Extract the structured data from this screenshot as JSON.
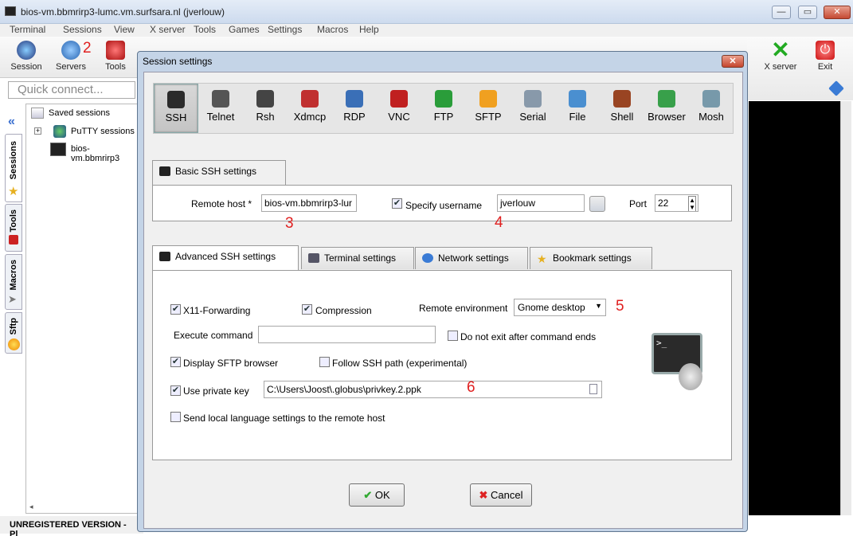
{
  "window": {
    "title": "bios-vm.bbmrirp3-lumc.vm.surfsara.nl (jverlouw)",
    "minimize": "—",
    "maximize": "▭",
    "close": "✕"
  },
  "menu": [
    "Terminal",
    "Sessions",
    "View",
    "X server",
    "Tools",
    "Games",
    "Settings",
    "Macros",
    "Help"
  ],
  "toolbar": {
    "session": "Session",
    "servers": "Servers",
    "servers_badge": "2",
    "tools": "Tools",
    "xserver": "X server",
    "exit": "Exit"
  },
  "quick_connect": {
    "placeholder": "Quick connect..."
  },
  "sidebar": {
    "tabs": [
      "Sessions",
      "Tools",
      "Macros",
      "Sftp"
    ]
  },
  "tree": {
    "root": "Saved sessions",
    "putty": "PuTTY sessions",
    "session": "bios-vm.bbmrirp3"
  },
  "status": {
    "text": "UNREGISTERED VERSION  -  Pl"
  },
  "dialog": {
    "title": "Session settings",
    "close": "✕",
    "protocols": [
      "SSH",
      "Telnet",
      "Rsh",
      "Xdmcp",
      "RDP",
      "VNC",
      "FTP",
      "SFTP",
      "Serial",
      "File",
      "Shell",
      "Browser",
      "Mosh"
    ],
    "protocol_colors": [
      "#2b2b2b",
      "#555555",
      "#444444",
      "#c03030",
      "#3a6fb7",
      "#c02020",
      "#2a9d3a",
      "#f0a020",
      "#8899aa",
      "#4a8fd0",
      "#994422",
      "#38a04a",
      "#7799aa"
    ],
    "basic": {
      "tab": "Basic SSH settings",
      "remote_host_label": "Remote host *",
      "remote_host": "bios-vm.bbmrirp3-lur",
      "specify_username": "Specify username",
      "username": "jverlouw",
      "port_label": "Port",
      "port": "22"
    },
    "annotations": {
      "a3": "3",
      "a4": "4",
      "a5": "5",
      "a6": "6"
    },
    "tabs": [
      "Advanced SSH settings",
      "Terminal settings",
      "Network settings",
      "Bookmark settings"
    ],
    "advanced": {
      "x11": "X11-Forwarding",
      "compression": "Compression",
      "remote_env_label": "Remote environment",
      "remote_env": "Gnome desktop",
      "exec_label": "Execute command",
      "exec_value": "",
      "no_exit": "Do not exit after command ends",
      "sftp_browser": "Display SFTP browser",
      "follow_ssh": "Follow SSH path (experimental)",
      "private_key": "Use private key",
      "key_path": "C:\\Users\\Joost\\.globus\\privkey.2.ppk",
      "send_lang": "Send local language settings to the remote host"
    },
    "ok": "OK",
    "cancel": "Cancel"
  }
}
